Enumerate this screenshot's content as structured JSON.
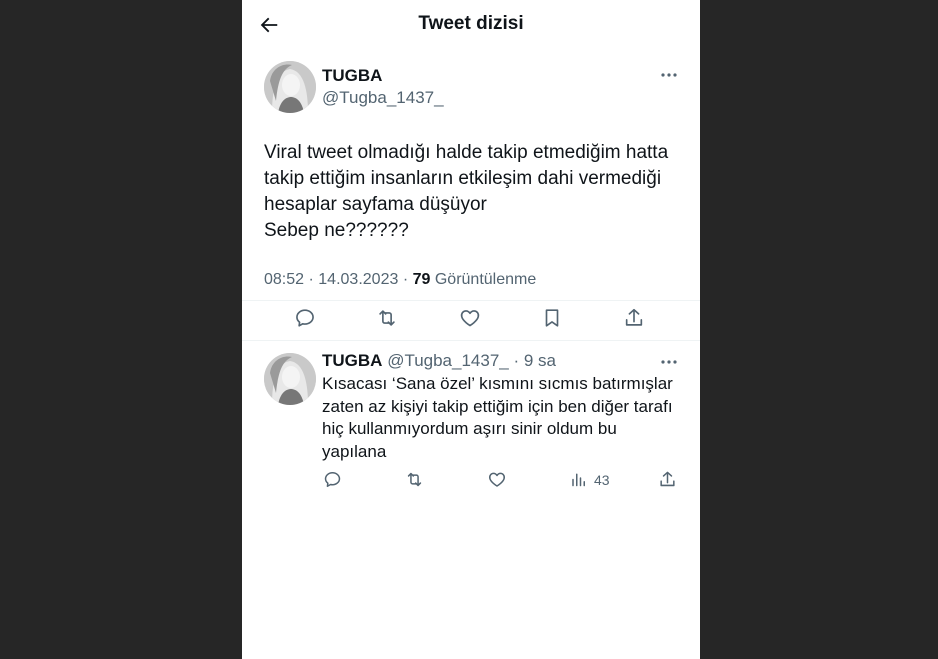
{
  "header": {
    "title": "Tweet dizisi"
  },
  "tweet": {
    "name": "TUGBA",
    "handle": "@Tugba_1437_",
    "lines": [
      "Viral tweet olmadığı halde takip etmediğim hatta",
      "takip ettiğim insanların etkileşim dahi vermediği",
      "hesaplar sayfama düşüyor",
      "Sebep ne??????"
    ],
    "time": "08:52",
    "date": "14.03.2023",
    "views_count": "79",
    "views_label": "Görüntülenme"
  },
  "reply": {
    "name": "TUGBA",
    "handle": "@Tugba_1437_",
    "age": "9 sa",
    "lines": [
      "Kısacası ‘Sana özel’ kısmını sıcmıs batırmışlar",
      "zaten az kişiyi takip ettiğim için ben diğer tarafı",
      "hiç kullanmıyordum aşırı sinir oldum bu",
      "yapılana"
    ],
    "views_count": "43"
  },
  "icons": {
    "back": "arrow-left-icon",
    "more": "more-dots-icon",
    "reply": "reply-icon",
    "retweet": "retweet-icon",
    "like": "heart-icon",
    "bookmark": "bookmark-icon",
    "share": "share-icon",
    "views": "bar-chart-icon"
  },
  "colors": {
    "text": "#0f1419",
    "secondary": "#536471",
    "divider": "#eff3f4",
    "background": "#262626"
  }
}
